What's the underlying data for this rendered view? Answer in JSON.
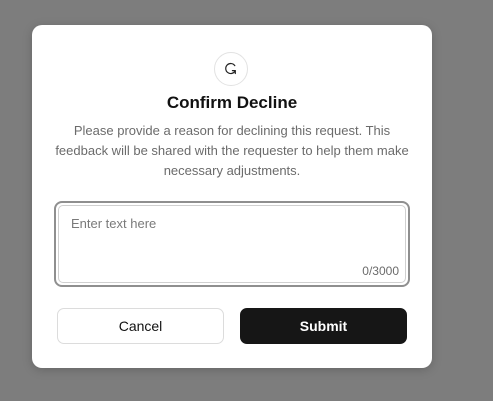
{
  "dialog": {
    "icon": "redo-icon",
    "title": "Confirm Decline",
    "description": "Please provide a reason for declining this request. This feedback will be shared with the requester to help them make necessary adjustments.",
    "reason_input": {
      "value": "",
      "placeholder": "Enter text here",
      "counter": "0/3000"
    },
    "cancel_label": "Cancel",
    "submit_label": "Submit"
  },
  "colors": {
    "overlay": "#7d7d7d",
    "modal_bg": "#ffffff",
    "primary_button": "#161616",
    "muted_text": "#6b6b6b"
  }
}
